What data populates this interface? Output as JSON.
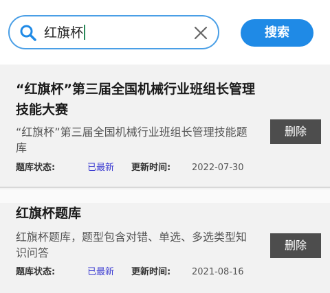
{
  "search": {
    "query": "红旗杯",
    "button_label": "搜索"
  },
  "results": [
    {
      "title": "“红旗杯”第三届全国机械行业班组长管理技能大赛",
      "description": "“红旗杯”第三届全国机械行业班组长管理技能题库",
      "status_label": "题库状态:",
      "status_value": "已最新",
      "updated_label": "更新时间:",
      "updated_value": "2022-07-30",
      "delete_label": "删除"
    },
    {
      "title": "红旗杯题库",
      "description": "红旗杯题库，题型包含对错、单选、多选类型知识问答",
      "status_label": "题库状态:",
      "status_value": "已最新",
      "updated_label": "更新时间:",
      "updated_value": "2021-08-16",
      "delete_label": "删除"
    }
  ],
  "colors": {
    "accent": "#1f8ae6",
    "search_border": "#4a9fe6",
    "status": "#3b3bd1",
    "delete_button": "#4d4d4d",
    "list_background": "#f2f2f2"
  },
  "icons": {
    "search": "search-icon",
    "clear": "close-icon"
  }
}
